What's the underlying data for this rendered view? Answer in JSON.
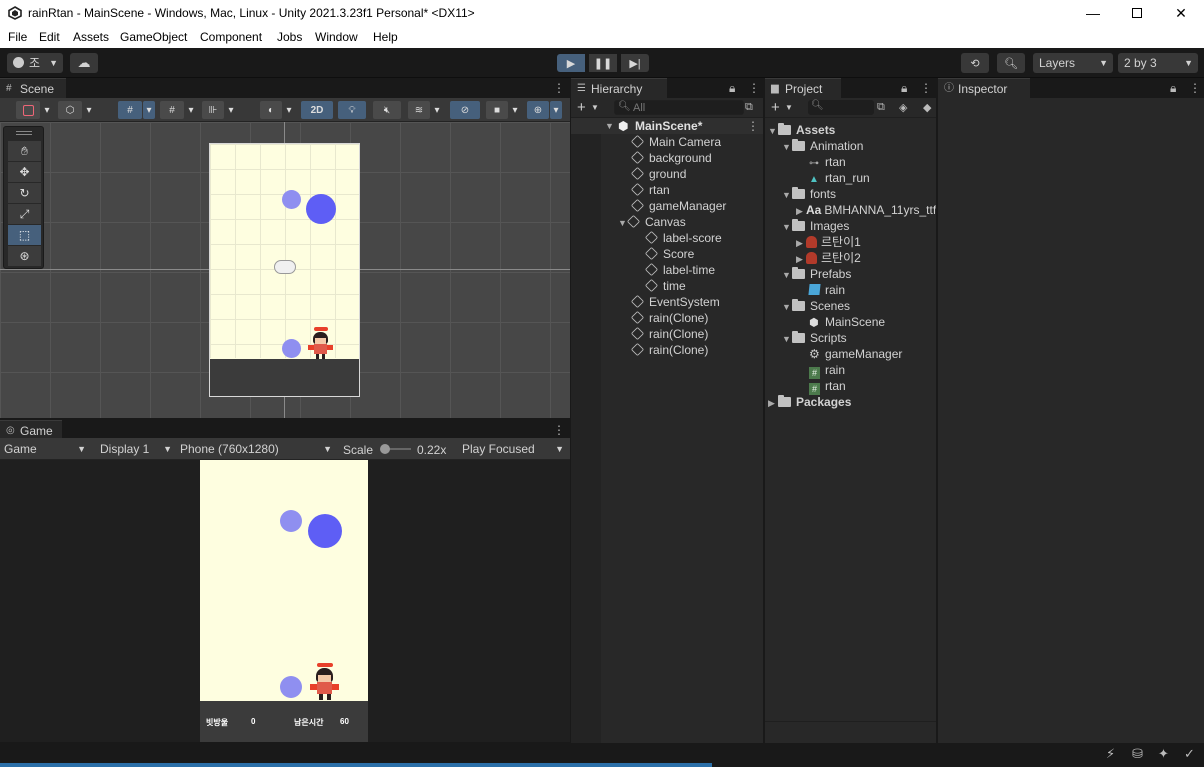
{
  "window": {
    "title": "rainRtan - MainScene - Windows, Mac, Linux - Unity 2021.3.23f1 Personal* <DX11>"
  },
  "menu": [
    "File",
    "Edit",
    "Assets",
    "GameObject",
    "Component",
    "Jobs",
    "Window",
    "Help"
  ],
  "toolbar": {
    "account_label": "조",
    "layers_label": "Layers",
    "layout_label": "2 by 3"
  },
  "scene": {
    "tab_label": "Scene",
    "mode_2d": "2D"
  },
  "game": {
    "tab_label": "Game",
    "view_select": "Game",
    "display_select": "Display 1",
    "resolution_select": "Phone (760x1280)",
    "scale_label": "Scale",
    "scale_value": "0.22x",
    "play_mode_select": "Play Focused",
    "hud": {
      "score_label": "빗방울",
      "score_value": "0",
      "time_label": "남은시간",
      "time_value": "60"
    }
  },
  "hierarchy": {
    "tab_label": "Hierarchy",
    "search_placeholder": "All",
    "scene_name": "MainScene*",
    "items": [
      "Main Camera",
      "background",
      "ground",
      "rtan",
      "gameManager",
      "Canvas",
      "label-score",
      "Score",
      "label-time",
      "time",
      "EventSystem",
      "rain(Clone)",
      "rain(Clone)",
      "rain(Clone)"
    ]
  },
  "project": {
    "tab_label": "Project",
    "root": "Assets",
    "animation_folder": "Animation",
    "anim_rtan": "rtan",
    "anim_rtan_run": "rtan_run",
    "fonts_folder": "fonts",
    "font_item": "BMHANNA_11yrs_ttf",
    "font_prefix": "Aa",
    "images_folder": "Images",
    "image1": "르탄이1",
    "image2": "르탄이2",
    "prefabs_folder": "Prefabs",
    "prefab_rain": "rain",
    "scenes_folder": "Scenes",
    "scene_main": "MainScene",
    "scripts_folder": "Scripts",
    "script_gm": "gameManager",
    "script_rain": "rain",
    "script_rtan": "rtan",
    "packages": "Packages"
  },
  "inspector": {
    "tab_label": "Inspector"
  },
  "colors": {
    "accent_blue": "#46607c",
    "rain_blue": "#5e5ef5",
    "rain_light": "#8f8ff0",
    "background_cream": "#fefee0"
  }
}
